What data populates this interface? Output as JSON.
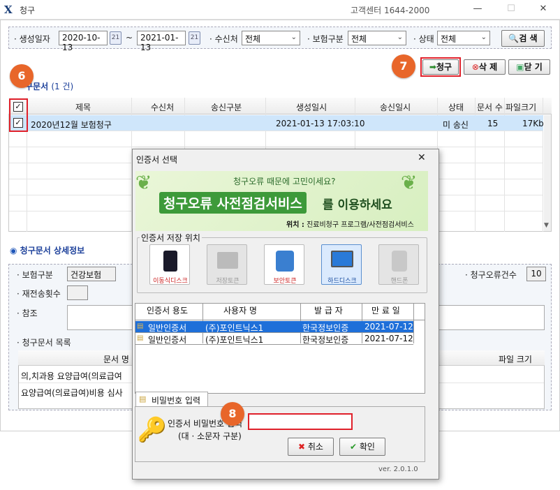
{
  "window": {
    "title": "청구",
    "center_label": "고객센터 1644-2000",
    "minimize": "—",
    "maximize": "☐",
    "close": "✕"
  },
  "filter": {
    "created_label": "생성일자",
    "date_from": "2020-10-13",
    "date_sep": "~",
    "date_to": "2021-01-13",
    "receiver_label": "수신처",
    "receiver_value": "전체",
    "insurance_label": "보험구분",
    "insurance_value": "전체",
    "status_label": "상태",
    "status_value": "전체",
    "search_label": "검 색"
  },
  "actions": {
    "claim_label": "청구",
    "delete_label": "삭 제",
    "close_label": "닫 기"
  },
  "steps": {
    "s6": "6",
    "s7": "7",
    "s8": "8"
  },
  "claim_list": {
    "title": "구문서",
    "count": "(1 건)",
    "headers": [
      "제목",
      "수신처",
      "송신구분",
      "생성일시",
      "송신일시",
      "상태",
      "문서 수",
      "파일크기"
    ],
    "rows": [
      {
        "title": "2020년12월 보험청구",
        "receiver": "",
        "send_type": "",
        "created": "2021-01-13 17:03:10",
        "sent": "",
        "status": "미 송신",
        "doc_count": "15",
        "size": "17Kb"
      }
    ]
  },
  "detail": {
    "title": "청구문서 상세정보",
    "insurance_label": "보험구분",
    "insurance_value": "건강보험",
    "error_count_label": "청구오류건수",
    "error_count_value": "10",
    "resend_label": "재전송횟수",
    "note_label": "참조",
    "doc_list_label": "청구문서 목록",
    "doc_header_name": "문서 명",
    "doc_header_size": "파일 크기",
    "docs": [
      "의,치과용 요양급여(의료급여",
      "요양급여(의료급여)비용 심사"
    ]
  },
  "dialog": {
    "title": "인증서 선택",
    "banner_top": "청구오류 때문에 고민이세요?",
    "banner_main": "청구오류 사전점검서비스",
    "banner_tail": "를 이용하세요",
    "banner_loc_label": "위치 :",
    "banner_loc": "진료비청구 프로그램/사전점검서비스",
    "storage_label": "인증서 저장 위치",
    "storage": [
      {
        "label": "이동식디스크"
      },
      {
        "label": "저장토큰"
      },
      {
        "label": "보안토큰"
      },
      {
        "label": "하드디스크"
      },
      {
        "label": "핸드폰"
      }
    ],
    "cert_headers": [
      "인증서 용도",
      "사용자 명",
      "발 급 자",
      "만 료 일"
    ],
    "certs": [
      {
        "usage": "일반인증서",
        "user": "(주)포인트닉스1",
        "issuer": "한국정보인증",
        "expire": "2021-07-12"
      },
      {
        "usage": "일반인증서",
        "user": "(주)포인트닉스1",
        "issuer": "한국정보인증",
        "expire": "2021-07-12"
      }
    ],
    "pw_tab": "비밀번호 입력",
    "pw_label": "인증서 비밀번호 입력",
    "pw_hint": "(대 · 소문자 구분)",
    "cancel_label": "취소",
    "ok_label": "확인",
    "version": "ver. 2.0.1.0"
  }
}
